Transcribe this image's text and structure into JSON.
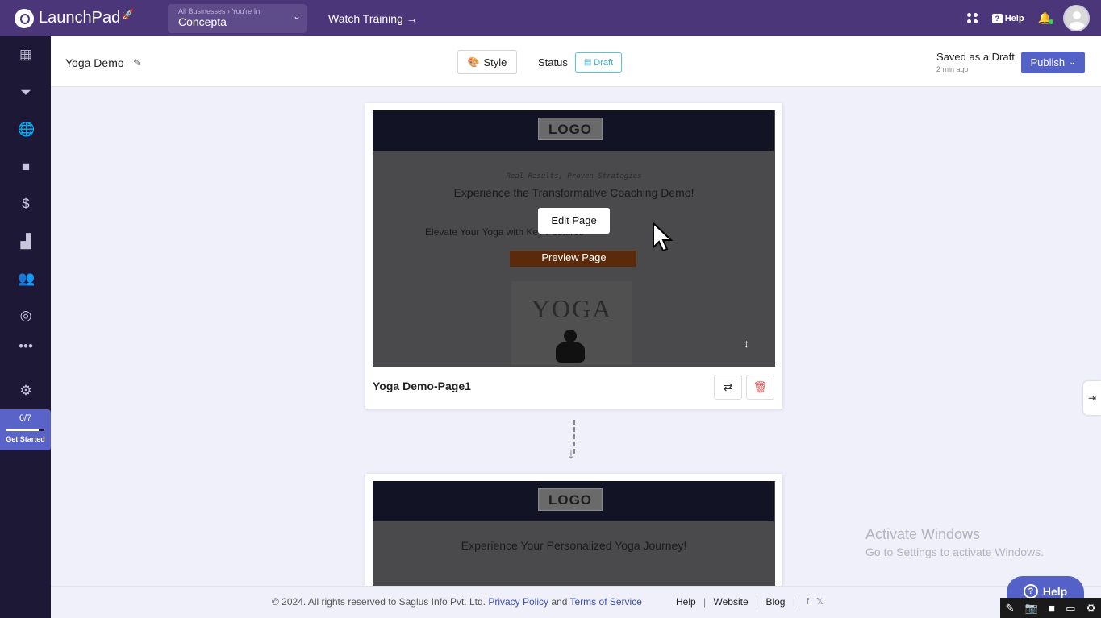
{
  "app": {
    "name": "LaunchPad"
  },
  "topbar": {
    "business_small": "All Businesses › You're In",
    "business_name": "Concepta",
    "watch_training": "Watch Training →",
    "help": "Help"
  },
  "sidebar": {
    "items": [
      {
        "icon": "dashboard-icon"
      },
      {
        "icon": "funnel-icon"
      },
      {
        "icon": "globe-icon"
      },
      {
        "icon": "video-icon"
      },
      {
        "icon": "dollar-icon"
      },
      {
        "icon": "analytics-icon"
      },
      {
        "icon": "users-icon"
      },
      {
        "icon": "gauge-icon"
      },
      {
        "icon": "more-icon"
      },
      {
        "icon": "gear-icon"
      }
    ],
    "progress": {
      "count": "6/7",
      "label": "Get Started",
      "fraction": 0.857
    }
  },
  "header": {
    "page_name": "Yoga Demo",
    "style_label": "Style",
    "status_label": "Status",
    "status_value": "Draft",
    "saved_text": "Saved as a Draft",
    "saved_time": "2 min ago",
    "publish_label": "Publish"
  },
  "pages": [
    {
      "title": "Yoga Demo-Page1",
      "preview": {
        "logo": "LOGO",
        "subheading": "Real Results, Proven Strategies",
        "heading": "Experience the Transformative Coaching Demo!",
        "text": "Elevate Your Yoga with Key Postures",
        "image_text": "YOGA"
      },
      "edit_label": "Edit Page",
      "preview_label": "Preview Page"
    },
    {
      "preview": {
        "logo": "LOGO",
        "heading": "Experience Your Personalized Yoga Journey!"
      }
    }
  ],
  "watermark": {
    "line1": "Activate Windows",
    "line2": "Go to Settings to activate Windows."
  },
  "footer": {
    "copyright": "©  2024. All rights reserved to Saglus Info Pvt. Ltd.",
    "privacy": "Privacy Policy",
    "and": "and",
    "terms": "Terms of Service",
    "links": [
      "Help",
      "Website",
      "Blog"
    ],
    "separator": "|"
  },
  "help_float": "Help",
  "colors": {
    "topbar": "#4a3678",
    "sidebar": "#1c1836",
    "accent": "#5461c6",
    "draft": "#38b4cf",
    "canvas": "#f0f0fb"
  }
}
